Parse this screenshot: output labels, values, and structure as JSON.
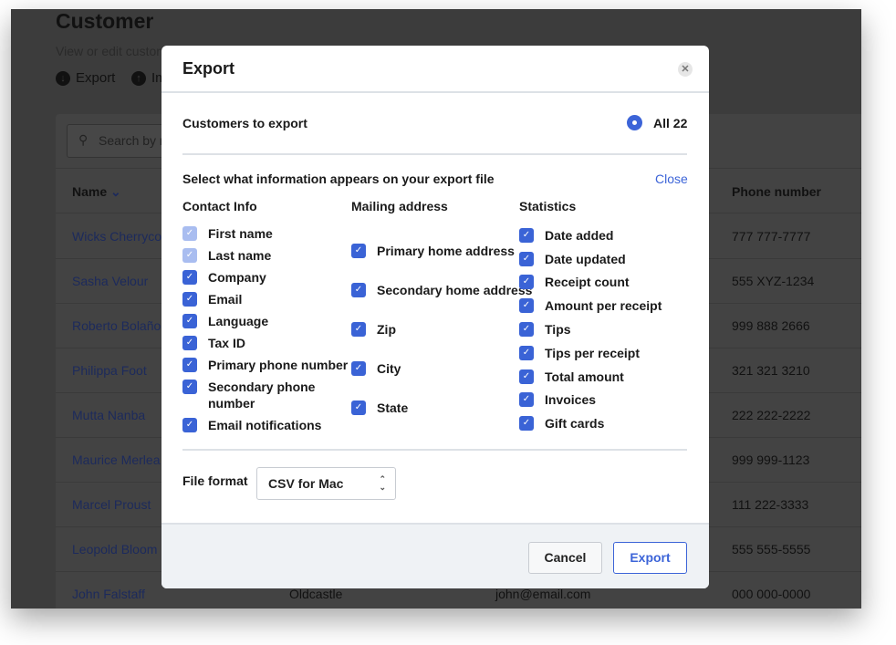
{
  "page": {
    "title": "Customer",
    "subtitle": "View or edit custon",
    "export_label": "Export",
    "import_label": "Im",
    "search_placeholder": "Search by n",
    "columns": {
      "name": "Name",
      "phone": "Phone number"
    },
    "rows": [
      {
        "name": "Wicks Cherryco",
        "phone": "777 777-7777"
      },
      {
        "name": "Sasha Velour",
        "phone": "555 XYZ-1234"
      },
      {
        "name": "Roberto Bolaño",
        "phone": "999 888 2666"
      },
      {
        "name": "Philippa Foot",
        "phone": "321 321 3210"
      },
      {
        "name": "Mutta Nanba",
        "phone": "222 222-2222"
      },
      {
        "name": "Maurice Merlea",
        "phone": "999 999-1123"
      },
      {
        "name": "Marcel Proust",
        "phone": "111 222-3333"
      },
      {
        "name": "Leopold Bloom",
        "phone": "555 555-5555"
      },
      {
        "name": "John Falstaff",
        "company": "Oldcastle",
        "email": "john@email.com",
        "phone": "000 000-0000"
      }
    ]
  },
  "modal": {
    "title": "Export",
    "close_icon": "close-icon",
    "customers_label": "Customers to export",
    "customers_option": "All 22",
    "select_label": "Select what information appears on your export file",
    "close_link": "Close",
    "groups": [
      {
        "title": "Contact Info",
        "items": [
          {
            "label": "First name",
            "checked": true,
            "disabled": true
          },
          {
            "label": "Last name",
            "checked": true,
            "disabled": true
          },
          {
            "label": "Company",
            "checked": true
          },
          {
            "label": "Email",
            "checked": true
          },
          {
            "label": "Language",
            "checked": true
          },
          {
            "label": "Tax ID",
            "checked": true
          },
          {
            "label": "Primary phone number",
            "checked": true
          },
          {
            "label": "Secondary phone number",
            "checked": true
          },
          {
            "label": "Email notifications",
            "checked": true
          }
        ]
      },
      {
        "title": "Mailing address",
        "items": [
          {
            "label": "Primary home address",
            "checked": true
          },
          {
            "label": "Secondary home address",
            "checked": true
          },
          {
            "label": "Zip",
            "checked": true
          },
          {
            "label": "City",
            "checked": true
          },
          {
            "label": "State",
            "checked": true
          }
        ]
      },
      {
        "title": "Statistics",
        "items": [
          {
            "label": "Date added",
            "checked": true
          },
          {
            "label": "Date updated",
            "checked": true
          },
          {
            "label": "Receipt count",
            "checked": true
          },
          {
            "label": "Amount per receipt",
            "checked": true
          },
          {
            "label": "Tips",
            "checked": true
          },
          {
            "label": "Tips per receipt",
            "checked": true
          },
          {
            "label": "Total amount",
            "checked": true
          },
          {
            "label": "Invoices",
            "checked": true
          },
          {
            "label": "Gift cards",
            "checked": true
          }
        ]
      }
    ],
    "file_format_label": "File format",
    "file_format_value": "CSV for Mac",
    "cancel_label": "Cancel",
    "export_label": "Export",
    "accent": "#3c64d8"
  }
}
